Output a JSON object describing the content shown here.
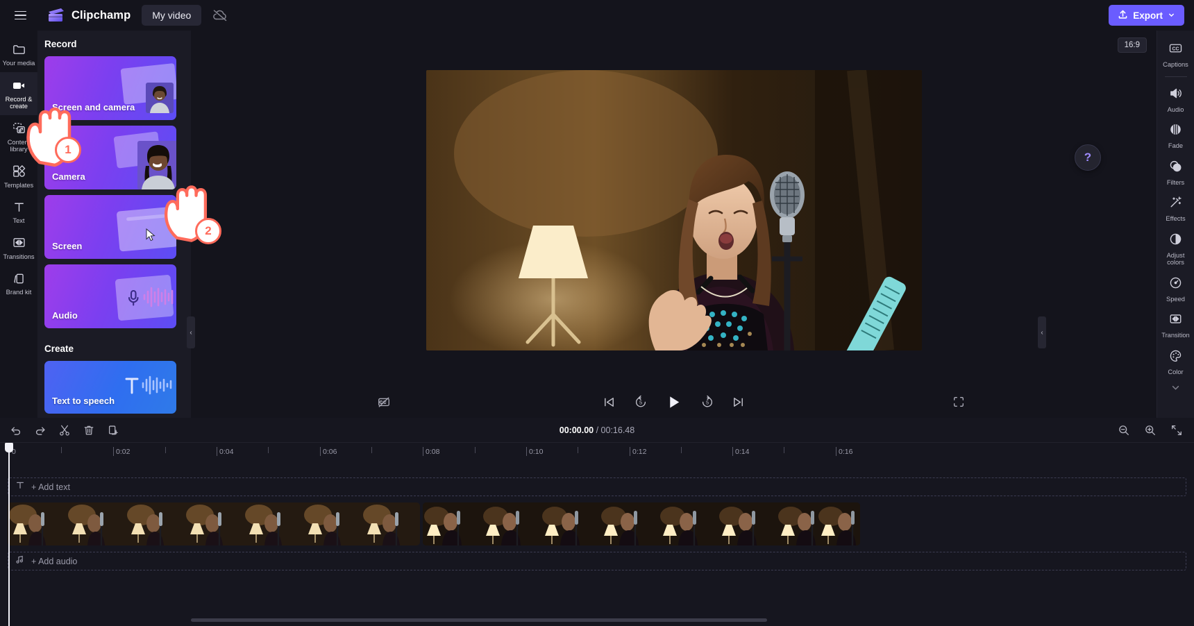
{
  "topbar": {
    "menu_icon": "hamburger-icon",
    "brand": "Clipchamp",
    "project_title": "My video",
    "cloud_icon": "cloud-off-icon",
    "export_label": "Export",
    "export_icon": "upload-icon",
    "export_chevron": "chevron-down-icon",
    "accent": "#6a5cff"
  },
  "left_rail": {
    "items": [
      {
        "label": "Your media",
        "icon": "folder-icon",
        "active": false
      },
      {
        "label": "Record & create",
        "icon": "video-camera-icon",
        "active": true
      },
      {
        "label": "Content library",
        "icon": "content-library-icon",
        "active": false
      },
      {
        "label": "Templates",
        "icon": "templates-icon",
        "active": false
      },
      {
        "label": "Text",
        "icon": "text-icon",
        "active": false
      },
      {
        "label": "Transitions",
        "icon": "transitions-icon",
        "active": false
      },
      {
        "label": "Brand kit",
        "icon": "brand-kit-icon",
        "active": false
      }
    ]
  },
  "panel": {
    "record_heading": "Record",
    "record_cards": [
      {
        "label": "Screen and camera",
        "art": "screen-and-camera-art"
      },
      {
        "label": "Camera",
        "art": "camera-art"
      },
      {
        "label": "Screen",
        "art": "screen-art"
      },
      {
        "label": "Audio",
        "art": "audio-art"
      }
    ],
    "create_heading": "Create",
    "create_cards": [
      {
        "label": "Text to speech",
        "art": "text-to-speech-art"
      }
    ]
  },
  "stage": {
    "aspect_ratio": "16:9",
    "captions_toggle_icon": "captions-off-icon",
    "controls": [
      {
        "name": "skip-to-start",
        "icon": "skip-start-icon"
      },
      {
        "name": "rewind-5s",
        "icon": "rewind-5-icon"
      },
      {
        "name": "play",
        "icon": "play-icon"
      },
      {
        "name": "forward-5s",
        "icon": "forward-5-icon"
      },
      {
        "name": "skip-to-end",
        "icon": "skip-end-icon"
      }
    ],
    "fullscreen_icon": "fullscreen-icon",
    "help_label": "?"
  },
  "right_rail": {
    "items": [
      {
        "label": "Captions",
        "icon": "closed-captions-icon"
      },
      {
        "label": "Audio",
        "icon": "speaker-icon"
      },
      {
        "label": "Fade",
        "icon": "fade-icon"
      },
      {
        "label": "Filters",
        "icon": "filters-icon"
      },
      {
        "label": "Effects",
        "icon": "magic-wand-icon"
      },
      {
        "label": "Adjust colors",
        "icon": "contrast-icon"
      },
      {
        "label": "Speed",
        "icon": "speedometer-icon"
      },
      {
        "label": "Transition",
        "icon": "transition-icon"
      },
      {
        "label": "Color",
        "icon": "palette-icon"
      }
    ],
    "more_chevron": "chevron-down-icon"
  },
  "timeline": {
    "tools": [
      {
        "name": "undo",
        "icon": "undo-icon"
      },
      {
        "name": "redo",
        "icon": "redo-icon"
      },
      {
        "name": "split",
        "icon": "scissors-icon"
      },
      {
        "name": "delete",
        "icon": "trash-icon"
      },
      {
        "name": "duplicate",
        "icon": "duplicate-icon"
      }
    ],
    "current_time": "00:00.00",
    "separator": " / ",
    "total_time": "00:16.48",
    "zoom_tools": [
      {
        "name": "zoom-out",
        "icon": "zoom-out-icon"
      },
      {
        "name": "zoom-in",
        "icon": "zoom-in-icon"
      },
      {
        "name": "fit-to-timeline",
        "icon": "fit-icon"
      }
    ],
    "ruler_labels": [
      "0",
      "0:02",
      "0:04",
      "0:06",
      "0:08",
      "0:10",
      "0:12",
      "0:14",
      "0:16"
    ],
    "text_track_label": "+ Add text",
    "text_track_icon": "text-icon",
    "audio_track_label": "+ Add audio",
    "audio_track_icon": "music-note-icon",
    "playhead_position": "0"
  },
  "tutorial": {
    "steps": [
      {
        "number": "1",
        "target": "camera-record-card"
      },
      {
        "number": "2",
        "target": "screen-record-card"
      }
    ],
    "highlight_color": "#ff6b5b"
  },
  "collapse_handles": [
    {
      "name": "collapse-panel-left",
      "icon": "chevron-left-icon"
    },
    {
      "name": "collapse-panel-right",
      "icon": "chevron-left-icon"
    }
  ]
}
